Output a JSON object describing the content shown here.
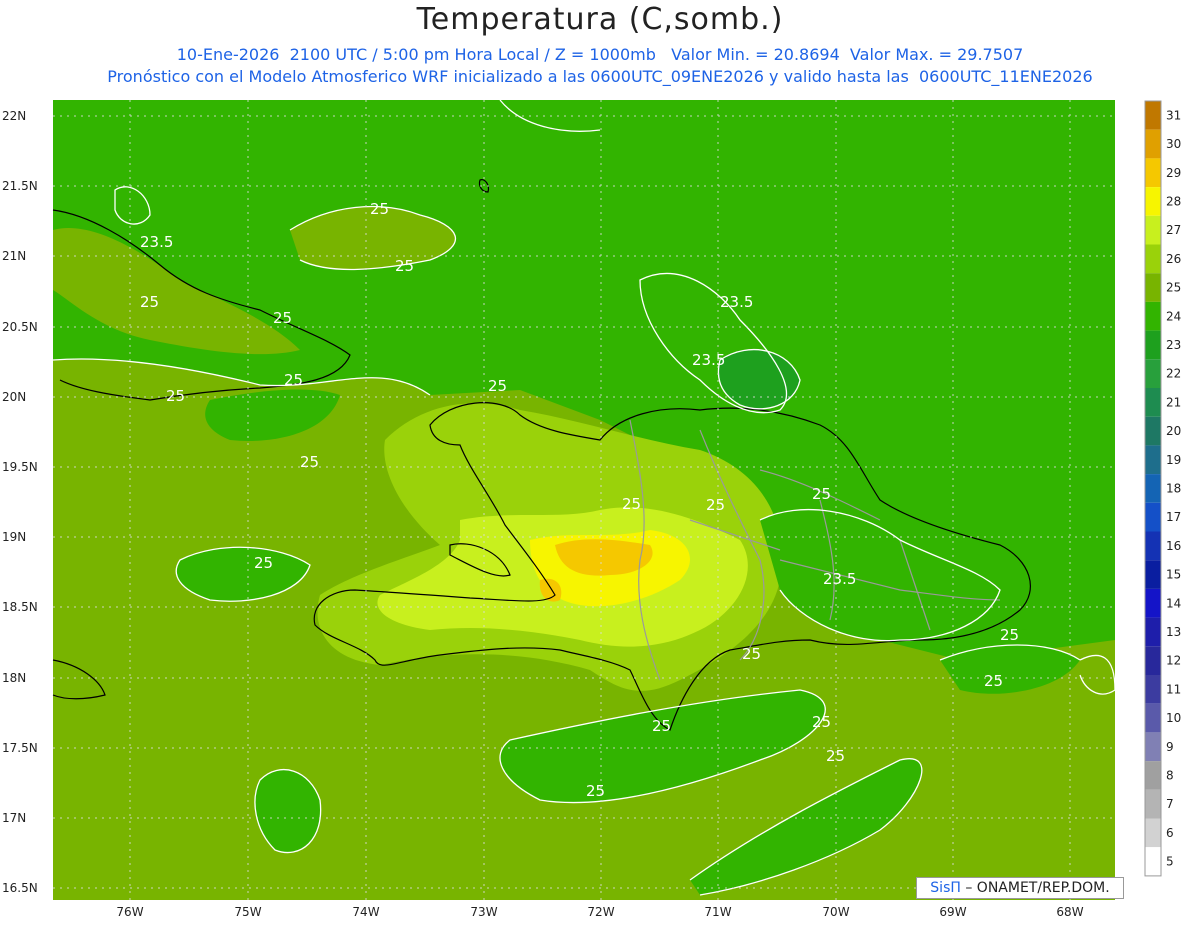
{
  "header": {
    "title": "Temperatura (C,somb.)",
    "subtitle1": "10-Ene-2026  2100 UTC / 5:00 pm Hora Local / Z = 1000mb   Valor Min. = 20.8694  Valor Max. = 29.7507",
    "subtitle2": "Pronóstico con el Modelo Atmosferico WRF inicializado a las 0600UTC_09ENE2026 y valido hasta las  0600UTC_11ENE2026"
  },
  "axes": {
    "lat_labels": [
      "22N",
      "21.5N",
      "21N",
      "20.5N",
      "20N",
      "19.5N",
      "19N",
      "18.5N",
      "18N",
      "17.5N",
      "17N",
      "16.5N"
    ],
    "lon_labels": [
      "76W",
      "75W",
      "74W",
      "73W",
      "72W",
      "71W",
      "70W",
      "69W",
      "68W"
    ]
  },
  "colorbar": {
    "levels": [
      "31",
      "30",
      "29",
      "28",
      "27",
      "26",
      "25",
      "24",
      "23",
      "22",
      "21",
      "20",
      "19",
      "18",
      "17",
      "16",
      "15",
      "14",
      "13",
      "12",
      "11",
      "10",
      "9",
      "8",
      "7",
      "6",
      "5"
    ],
    "colors": [
      "#c07800",
      "#e0a000",
      "#f5c800",
      "#f7f500",
      "#c8f01e",
      "#9ad20a",
      "#78b400",
      "#32b400",
      "#1ea01e",
      "#28a03c",
      "#1e8c50",
      "#1e7864",
      "#1e6e8c",
      "#1464b4",
      "#1450c8",
      "#1432b4",
      "#0a1ea0",
      "#1414c8",
      "#1e1eaa",
      "#28289b",
      "#3c3ca0",
      "#5a5aaa",
      "#8080b4",
      "#a0a0a0",
      "#b4b4b4",
      "#d2d2d2",
      "#ffffff"
    ]
  },
  "contours": [
    "25",
    "23.5",
    "25",
    "25",
    "25",
    "25",
    "25",
    "23.5",
    "23.5",
    "25",
    "25",
    "25",
    "25",
    "25",
    "23.5",
    "25",
    "25",
    "25",
    "25",
    "25",
    "25",
    "25",
    "25"
  ],
  "credit": {
    "logo": "SisΠ",
    "text": " – ONAMET/REP.DOM."
  }
}
